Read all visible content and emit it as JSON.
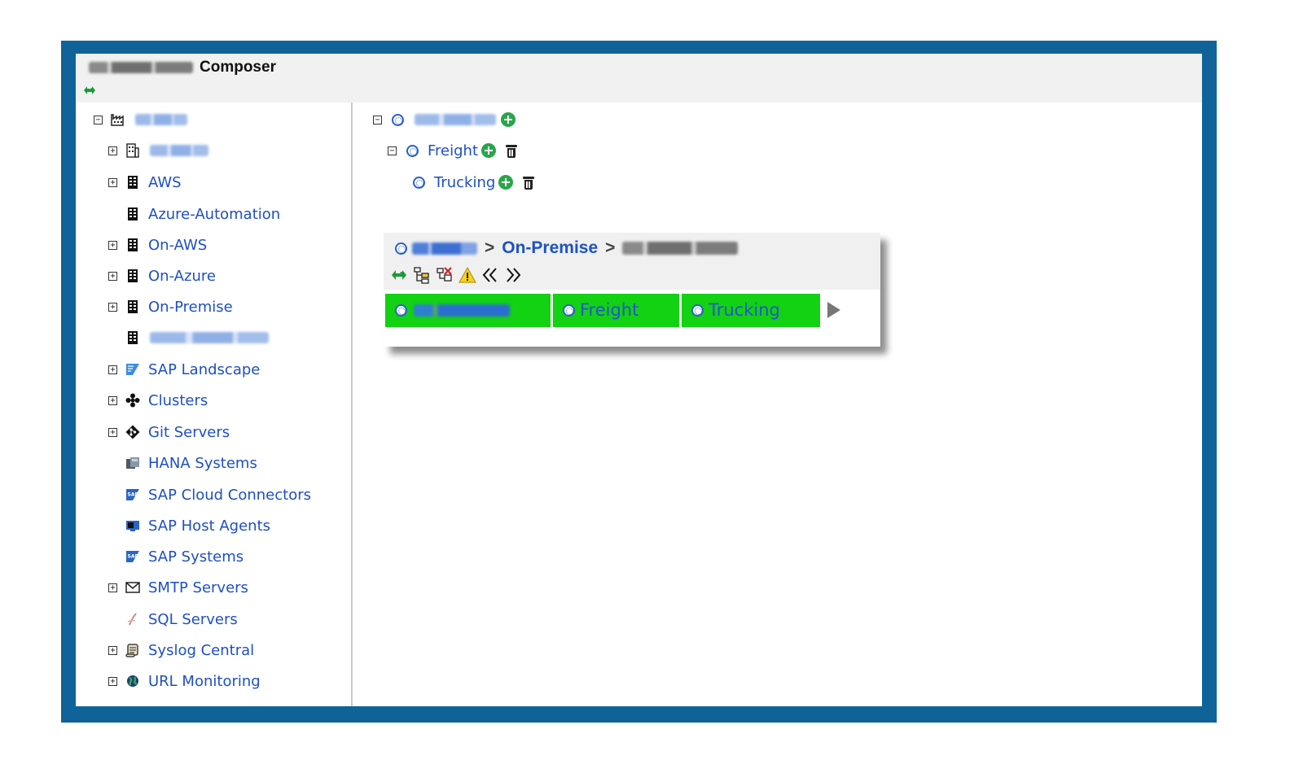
{
  "app": {
    "title_prefix_redacted": true,
    "title": "Composer"
  },
  "sidebar": {
    "items": [
      {
        "label": "",
        "redacted": true,
        "toggle": "minus",
        "icon": "factory-icon"
      },
      {
        "label": "",
        "redacted": true,
        "toggle": "plus",
        "icon": "building-outline-icon"
      },
      {
        "label": "AWS",
        "toggle": "plus",
        "icon": "building-icon"
      },
      {
        "label": "Azure-Automation",
        "toggle": "",
        "icon": "building-icon"
      },
      {
        "label": "On-AWS",
        "toggle": "plus",
        "icon": "building-icon"
      },
      {
        "label": "On-Azure",
        "toggle": "plus",
        "icon": "building-icon"
      },
      {
        "label": "On-Premise",
        "toggle": "plus",
        "icon": "building-icon"
      },
      {
        "label": "",
        "redacted": true,
        "toggle": "",
        "icon": "building-icon"
      },
      {
        "label": "SAP Landscape",
        "toggle": "plus",
        "icon": "sap-landscape-icon"
      },
      {
        "label": "Clusters",
        "toggle": "plus",
        "icon": "cluster-icon"
      },
      {
        "label": "Git Servers",
        "toggle": "plus",
        "icon": "git-icon"
      },
      {
        "label": "HANA Systems",
        "toggle": "",
        "icon": "hana-icon"
      },
      {
        "label": "SAP Cloud Connectors",
        "toggle": "",
        "icon": "sap-icon"
      },
      {
        "label": "SAP Host Agents",
        "toggle": "",
        "icon": "sap-host-icon"
      },
      {
        "label": "SAP Systems",
        "toggle": "",
        "icon": "sap-icon"
      },
      {
        "label": "SMTP Servers",
        "toggle": "plus",
        "icon": "envelope-icon"
      },
      {
        "label": "SQL Servers",
        "toggle": "",
        "icon": "sql-icon"
      },
      {
        "label": "Syslog Central",
        "toggle": "plus",
        "icon": "scroll-icon"
      },
      {
        "label": "URL Monitoring",
        "toggle": "plus",
        "icon": "globe-icon"
      }
    ]
  },
  "main": {
    "tree": [
      {
        "label": "",
        "redacted": true,
        "toggle": "minus"
      },
      {
        "label": "Freight",
        "toggle": "minus"
      },
      {
        "label": "Trucking",
        "toggle": ""
      }
    ],
    "popup": {
      "breadcrumb": {
        "root_redacted": true,
        "separator": ">",
        "middle": "On-Premise",
        "current_redacted": true
      },
      "lanes": [
        {
          "label": "",
          "redacted": true
        },
        {
          "label": "Freight"
        },
        {
          "label": "Trucking"
        }
      ]
    }
  },
  "colors": {
    "frame": "#0f6398",
    "link": "#1e4fc2",
    "lane_green": "#13d113",
    "add_green": "#2aa54a"
  }
}
